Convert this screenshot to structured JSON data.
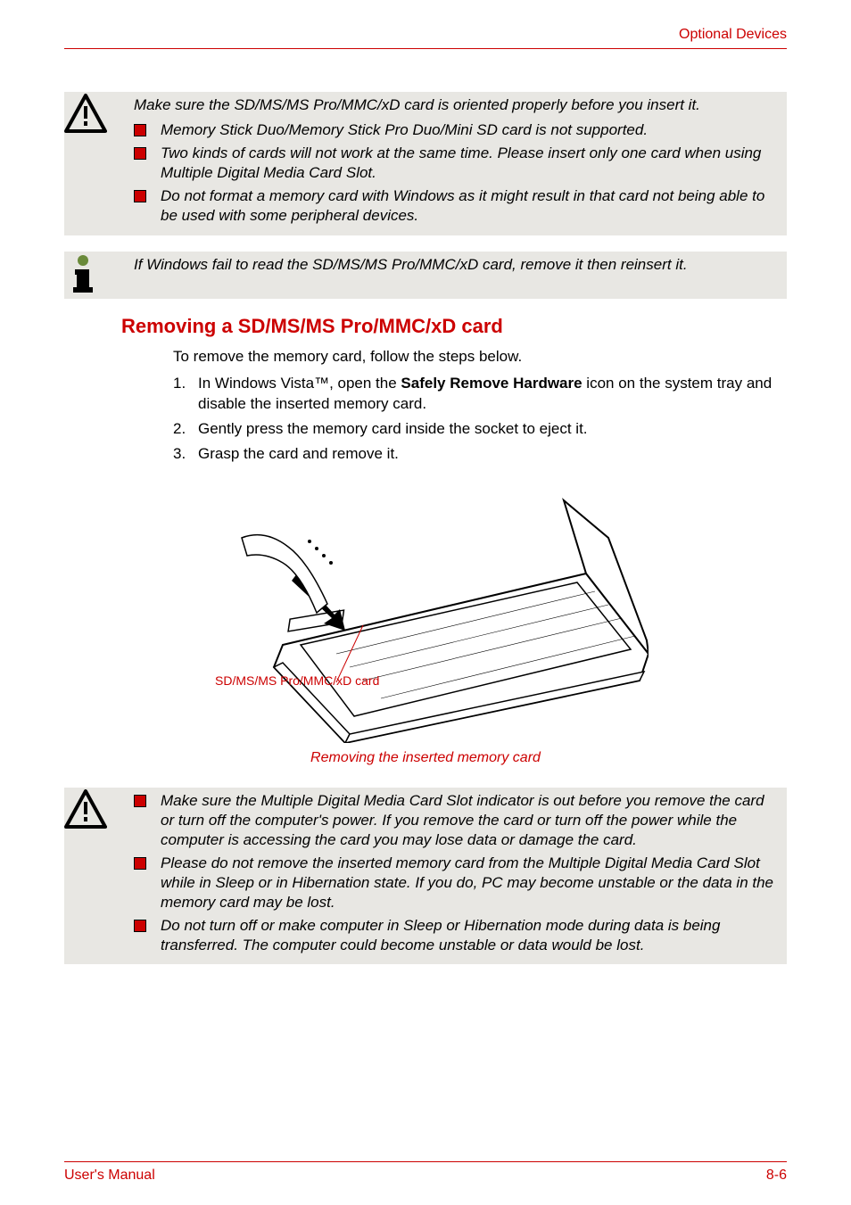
{
  "header": {
    "right": "Optional Devices"
  },
  "callout1": {
    "lead": "Make sure the SD/MS/MS Pro/MMC/xD card is oriented properly before you insert it.",
    "bullets": [
      "Memory Stick Duo/Memory Stick Pro Duo/Mini SD card is not supported.",
      "Two kinds of cards will not work at the same time. Please insert only one card when using Multiple Digital Media Card Slot.",
      "Do not format a memory card with Windows as it might result in that card not being able to be used with some peripheral devices."
    ]
  },
  "callout2": {
    "text": "If Windows fail to read the SD/MS/MS Pro/MMC/xD card, remove it then reinsert it."
  },
  "section": {
    "heading": "Removing a SD/MS/MS Pro/MMC/xD card",
    "intro": "To remove the memory card, follow the steps below.",
    "steps": {
      "s1a": "In Windows Vista™, open the ",
      "s1bold": "Safely Remove Hardware",
      "s1b": " icon on the system tray and disable the inserted memory card.",
      "s2": "Gently press the memory card inside the socket to eject it.",
      "s3": "Grasp the card and remove it."
    }
  },
  "figure": {
    "label": "SD/MS/MS Pro/MMC/xD card",
    "caption": "Removing the inserted memory card"
  },
  "callout3": {
    "bullets": [
      "Make sure the Multiple Digital Media Card Slot indicator is out before you remove the card or turn off the computer's power. If you remove the card or turn off the power while the computer is accessing the card you may lose data or damage the card.",
      "Please do not remove the inserted memory card from the Multiple Digital Media Card Slot while in Sleep or in Hibernation state. If you do, PC may become unstable or the data in the memory card may be lost.",
      "Do not turn off or make computer in Sleep or Hibernation mode during data is being transferred. The computer could become unstable or data would be lost."
    ]
  },
  "footer": {
    "left": "User's Manual",
    "right": "8-6"
  }
}
